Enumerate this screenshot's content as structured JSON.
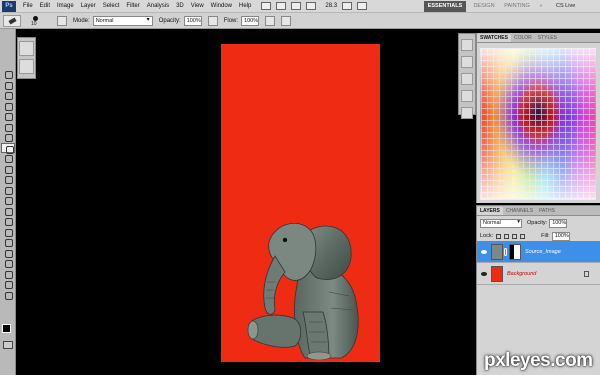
{
  "app": {
    "logo": "Ps"
  },
  "menu": [
    "File",
    "Edit",
    "Image",
    "Layer",
    "Select",
    "Filter",
    "Analysis",
    "3D",
    "View",
    "Window",
    "Help"
  ],
  "zoom": "28.3",
  "workspaces": {
    "active": "ESSENTIALS",
    "design": "DESIGN",
    "painting": "PAINTING",
    "more": "»",
    "cs_live": "CS Live"
  },
  "options": {
    "brush_size": "10",
    "mode_label": "Mode:",
    "mode_value": "Normal",
    "opacity_label": "Opacity:",
    "opacity_value": "100%",
    "flow_label": "Flow:",
    "flow_value": "100%"
  },
  "swatches_panel": {
    "tabs": [
      "SWATCHES",
      "COLOR",
      "STYLES"
    ],
    "active_tab": "SWATCHES"
  },
  "layers_panel": {
    "tabs": [
      "LAYERS",
      "CHANNELS",
      "PATHS"
    ],
    "blend_mode": "Normal",
    "opacity_label": "Opacity:",
    "opacity_value": "100%",
    "lock_label": "Lock:",
    "fill_label": "Fill:",
    "fill_value": "100%",
    "layers": [
      {
        "name": "Source_Image",
        "selected": true
      },
      {
        "name": "Background",
        "selected": false
      }
    ]
  },
  "canvas": {
    "background_color": "#ef2b14"
  },
  "watermark": "pxleyes.com",
  "colors": {
    "foreground": "#000000",
    "background": "#ffffff",
    "selection": "#3d8fe8"
  }
}
